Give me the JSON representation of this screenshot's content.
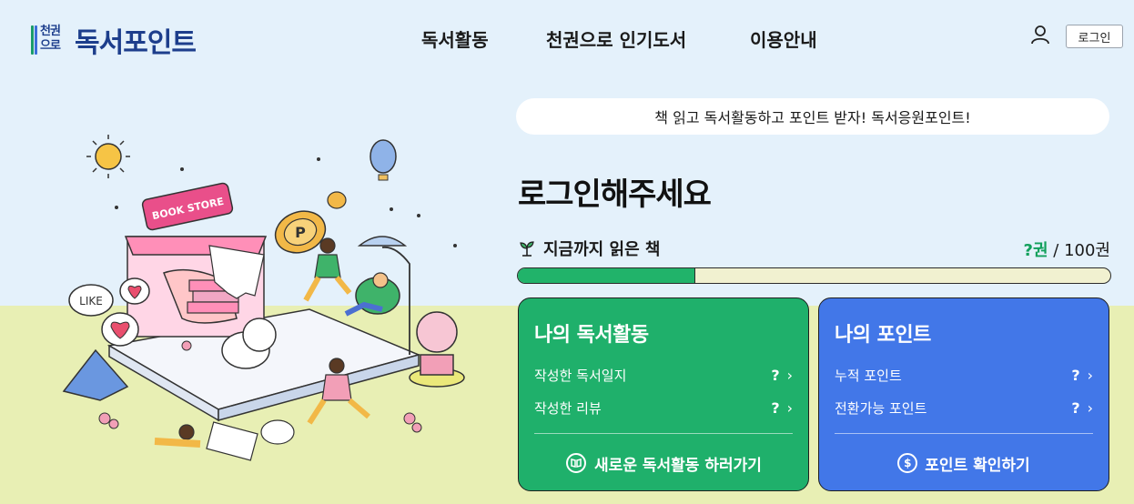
{
  "header": {
    "logo_mark_top": "천권",
    "logo_mark_bottom": "으로",
    "logo_text": "독서포인트",
    "nav": [
      "독서활동",
      "천권으로 인기도서",
      "이용안내"
    ],
    "login_label": "로그인"
  },
  "banner": {
    "text": "책 읽고 독서활동하고 포인트 받자! 독서응원포인트!"
  },
  "main": {
    "title": "로그인해주세요",
    "read_label": "지금까지 읽은 책",
    "read_current": "?권",
    "read_separator": " / ",
    "read_total": "100권",
    "progress_fraction": 0.3
  },
  "cards": {
    "activity": {
      "title": "나의 독서활동",
      "rows": [
        {
          "label": "작성한 독서일지",
          "value": "?"
        },
        {
          "label": "작성한 리뷰",
          "value": "?"
        }
      ],
      "action": "새로운 독서활동 하러가기"
    },
    "points": {
      "title": "나의 포인트",
      "rows": [
        {
          "label": "누적 포인트",
          "value": "?"
        },
        {
          "label": "전환가능 포인트",
          "value": "?"
        }
      ],
      "action": "포인트 확인하기",
      "action_icon": "$"
    }
  },
  "illustration": {
    "sign": "BOOK STORE",
    "bubble": "LIKE",
    "coin": "P"
  },
  "colors": {
    "accent_green": "#1fb06b",
    "accent_blue": "#4277e8",
    "brand_navy": "#1d3e8c",
    "sky": "#e4f1fb",
    "ground": "#e8efb4"
  }
}
